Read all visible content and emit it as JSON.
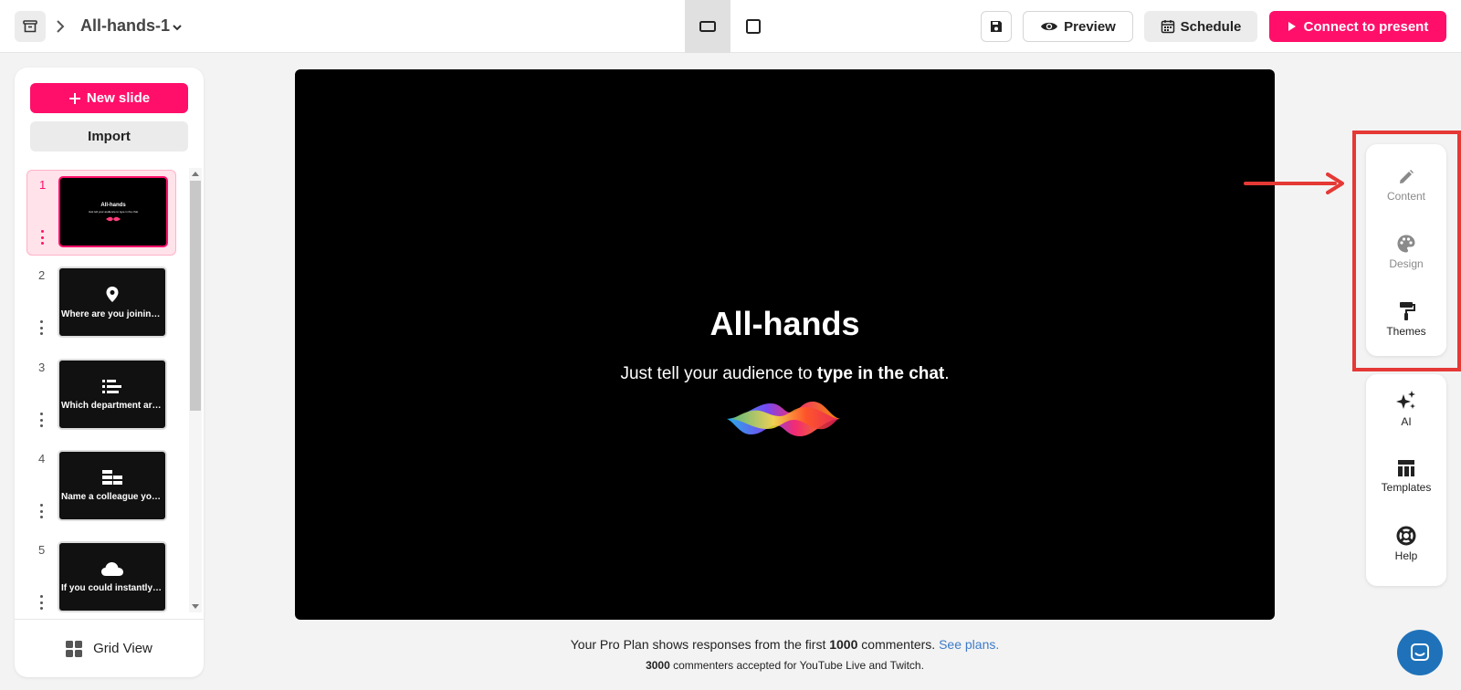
{
  "header": {
    "deck_title": "All-hands-1",
    "preview_label": "Preview",
    "schedule_label": "Schedule",
    "present_label": "Connect to present"
  },
  "sidebar": {
    "new_slide_label": "New slide",
    "import_label": "Import",
    "grid_view_label": "Grid View",
    "slides": [
      {
        "num": "1",
        "label": "",
        "mini_title": "All-hands",
        "mini_sub": "Just tell your audience to type in the chat",
        "icon": "logo-icon"
      },
      {
        "num": "2",
        "label": "Where are you joining from?",
        "icon": "location-pin-icon"
      },
      {
        "num": "3",
        "label": "Which department are you in?",
        "icon": "ranked-list-icon"
      },
      {
        "num": "4",
        "label": "Name a colleague you'd like to thank",
        "icon": "blocks-icon"
      },
      {
        "num": "5",
        "label": "If you could instantly improve one thing",
        "icon": "cloud-icon"
      }
    ]
  },
  "slide": {
    "title": "All-hands",
    "subtitle_plain": "Just tell your audience to ",
    "subtitle_bold": "type in the chat",
    "subtitle_end": "."
  },
  "footer": {
    "line1_pre": "Your Pro Plan shows responses from the first ",
    "line1_bold": "1000",
    "line1_post": " commenters. ",
    "line1_link": "See plans.",
    "line2_bold": "3000",
    "line2_post": " commenters accepted for YouTube Live and Twitch."
  },
  "rail": {
    "content": "Content",
    "design": "Design",
    "themes": "Themes",
    "ai": "AI",
    "templates": "Templates",
    "help": "Help"
  },
  "colors": {
    "brand": "#ff0f6a",
    "highlight": "#e53935",
    "link": "#3d7cc9",
    "chat": "#1f72b9"
  }
}
